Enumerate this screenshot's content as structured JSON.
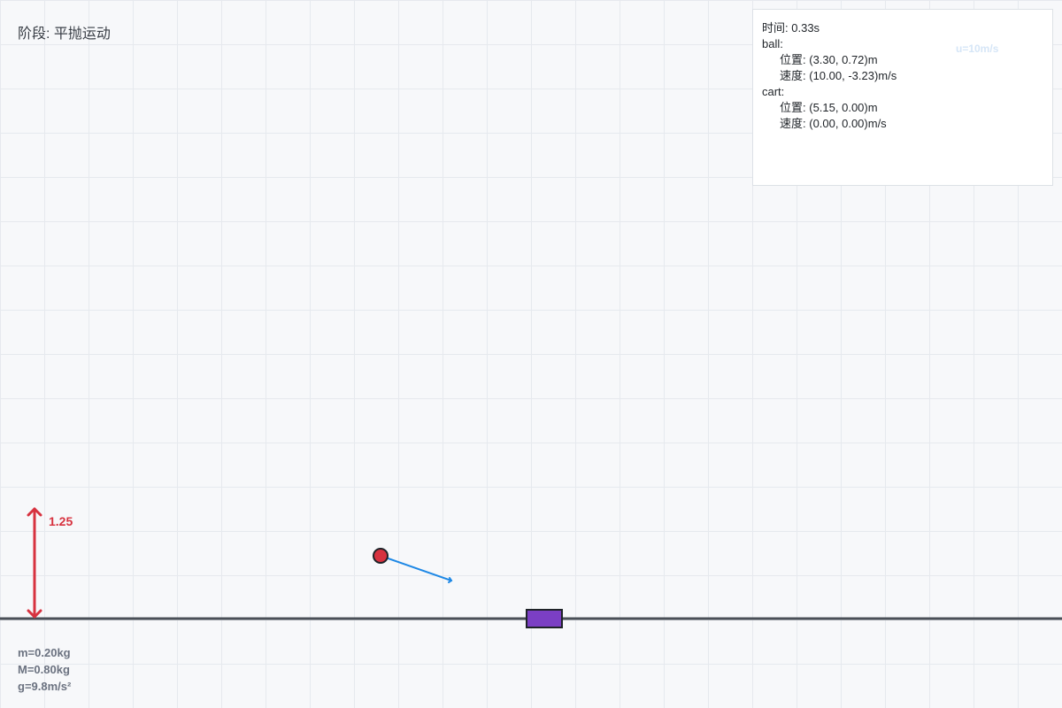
{
  "stage": {
    "label": "阶段",
    "value": "平抛运动"
  },
  "info": {
    "time_label": "时间",
    "time": "0.33s",
    "ball": {
      "name": "ball:",
      "pos_label": "位置",
      "pos": "(3.30, 0.72)m",
      "vel_label": "速度",
      "vel": "(10.00, -3.23)m/s"
    },
    "cart": {
      "name": "cart:",
      "pos_label": "位置",
      "pos": "(5.15, 0.00)m",
      "vel_label": "速度",
      "vel": "(0.00, 0.00)m/s"
    }
  },
  "velocity_note": "u=10m/s",
  "height_marker": "1.25",
  "params": {
    "m": "m=0.20kg",
    "M": "M=0.80kg",
    "g": "g=9.8m/s²"
  },
  "colors": {
    "ground": "#4a4f57",
    "ball": "#d7323f",
    "cart": "#7b3fc4",
    "velocity": "#1e88e5",
    "height": "#d7323f"
  }
}
